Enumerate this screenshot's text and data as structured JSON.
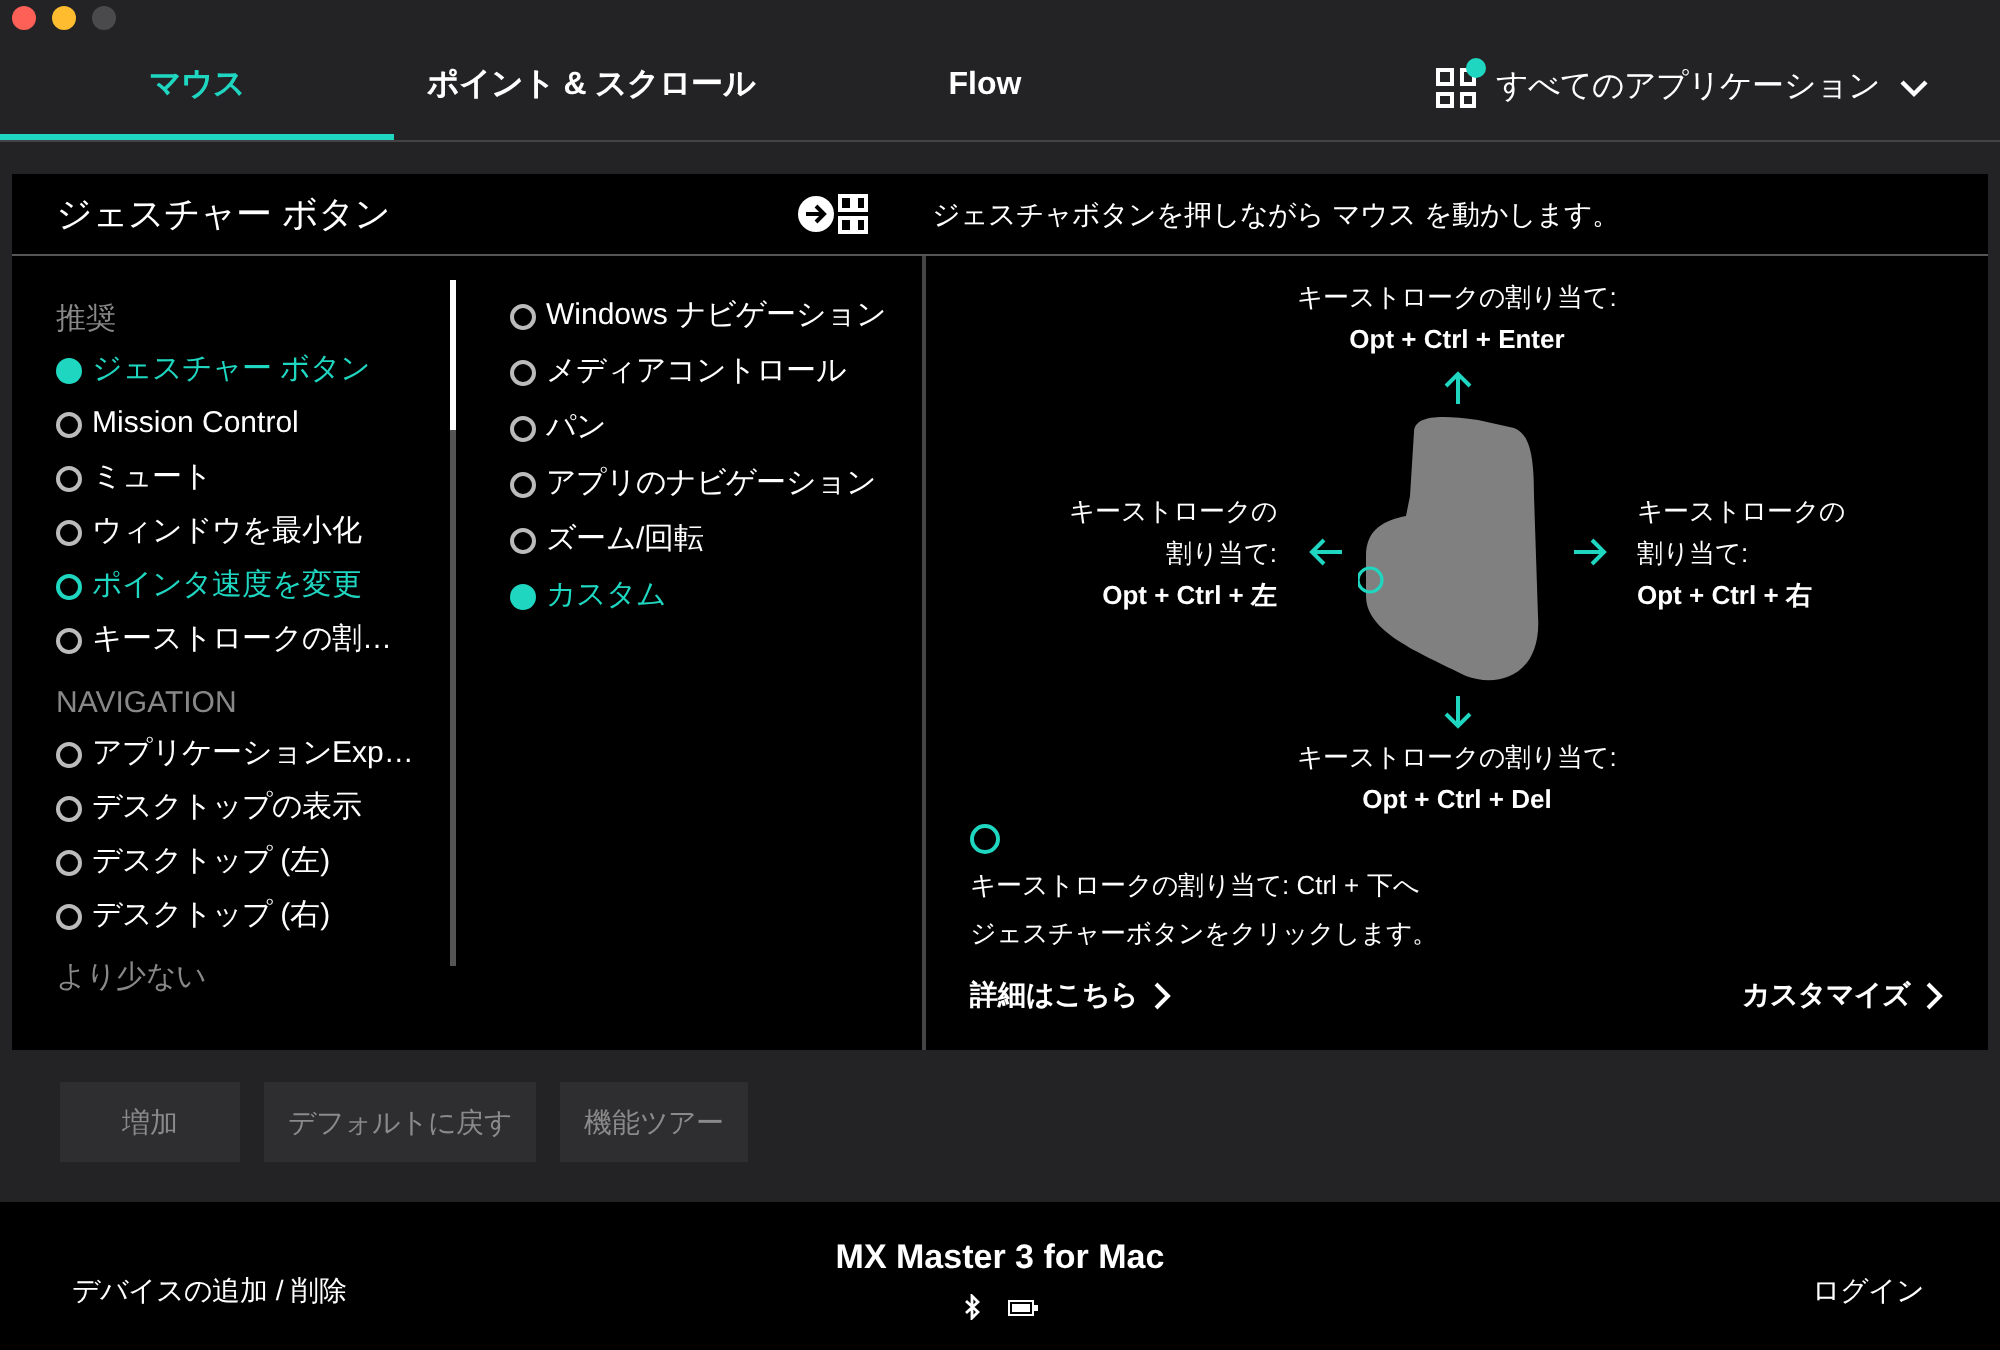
{
  "tabs": [
    {
      "label": "マウス",
      "selected": true
    },
    {
      "label": "ポイント & スクロール",
      "selected": false
    },
    {
      "label": "Flow",
      "selected": false
    }
  ],
  "app_selector": {
    "label": "すべてのアプリケーション"
  },
  "panel": {
    "title": "ジェスチャー ボタン",
    "hint": "ジェスチャボタンを押しながら マウス を動かします。"
  },
  "option_groups": [
    {
      "heading": "推奨",
      "items": [
        {
          "label": "ジェスチャー ボタン",
          "selected": true,
          "hovered": false
        },
        {
          "label": "Mission Control",
          "selected": false,
          "hovered": false
        },
        {
          "label": "ミュート",
          "selected": false,
          "hovered": false
        },
        {
          "label": "ウィンドウを最小化",
          "selected": false,
          "hovered": false
        },
        {
          "label": "ポインタ速度を変更",
          "selected": false,
          "hovered": true
        },
        {
          "label": "キーストロークの割…",
          "selected": false,
          "hovered": false
        }
      ]
    },
    {
      "heading": "NAVIGATION",
      "items": [
        {
          "label": "アプリケーションExp…",
          "selected": false,
          "hovered": false
        },
        {
          "label": "デスクトップの表示",
          "selected": false,
          "hovered": false
        },
        {
          "label": "デスクトップ (左)",
          "selected": false,
          "hovered": false
        },
        {
          "label": "デスクトップ (右)",
          "selected": false,
          "hovered": false
        }
      ]
    }
  ],
  "less_link": "より少ない",
  "gesture_modes": [
    {
      "label": "Windows ナビゲーション",
      "selected": false
    },
    {
      "label": "メディアコントロール",
      "selected": false
    },
    {
      "label": "パン",
      "selected": false
    },
    {
      "label": "アプリのナビゲーション",
      "selected": false
    },
    {
      "label": "ズーム/回転",
      "selected": false
    },
    {
      "label": "カスタム",
      "selected": true
    }
  ],
  "directions": [
    {
      "kind": "up",
      "label": [
        "キーストロークの割り当て:"
      ],
      "keys": "Opt + Ctrl + Enter"
    },
    {
      "kind": "left",
      "label": [
        "キーストロークの",
        "割り当て:"
      ],
      "keys": "Opt + Ctrl + 左"
    },
    {
      "kind": "right",
      "label": [
        "キーストロークの",
        "割り当て:"
      ],
      "keys": "Opt + Ctrl + 右"
    },
    {
      "kind": "down",
      "label": [
        "キーストロークの割り当て:"
      ],
      "keys": "Opt + Ctrl + Del"
    }
  ],
  "click_action": [
    "キーストロークの割り当て: Ctrl + 下へ",
    "ジェスチャーボタンをクリックします。"
  ],
  "links": {
    "details": "詳細はこちら",
    "customize": "カスタマイズ"
  },
  "buttons": [
    "増加",
    "デフォルトに戻す",
    "機能ツアー"
  ],
  "footer": {
    "left": "デバイスの追加 / 削除",
    "device": "MX Master 3 for Mac",
    "right": "ログイン"
  }
}
